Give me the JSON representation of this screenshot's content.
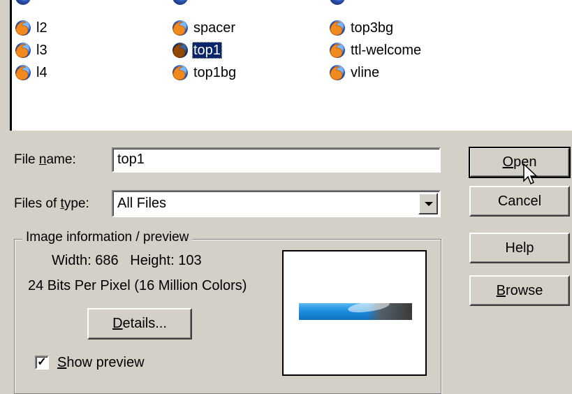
{
  "file_list": {
    "columns": [
      {
        "items": [
          {
            "name": "l2",
            "selected": false
          },
          {
            "name": "l3",
            "selected": false
          },
          {
            "name": "l4",
            "selected": false
          }
        ]
      },
      {
        "items": [
          {
            "name": "spacer",
            "selected": false
          },
          {
            "name": "top1",
            "selected": true
          },
          {
            "name": "top1bg",
            "selected": false
          }
        ]
      },
      {
        "items": [
          {
            "name": "top3bg",
            "selected": false
          },
          {
            "name": "ttl-welcome",
            "selected": false
          },
          {
            "name": "vline",
            "selected": false
          }
        ]
      }
    ]
  },
  "form": {
    "file_name_label_pre": "File ",
    "file_name_label_u": "n",
    "file_name_label_post": "ame:",
    "file_name_value": "top1",
    "files_type_label_pre": "Files of ",
    "files_type_label_u": "t",
    "files_type_label_post": "ype:",
    "files_type_value": "All Files"
  },
  "buttons": {
    "open_u": "O",
    "open_rest": "pen",
    "cancel": "Cancel",
    "help": "Help",
    "browse_u": "B",
    "browse_rest": "rowse"
  },
  "image_info": {
    "group_title": "Image information / preview",
    "dimensions": "Width: 686   Height: 103",
    "bits": "24 Bits Per Pixel (16 Million Colors)",
    "details_u": "D",
    "details_rest": "etails...",
    "show_preview_u": "S",
    "show_preview_rest": "how preview",
    "show_preview_checked": true,
    "check_mark": "✓"
  },
  "colors": {
    "dialog_bg": "#d4d0c8",
    "selection": "#0a246a"
  }
}
